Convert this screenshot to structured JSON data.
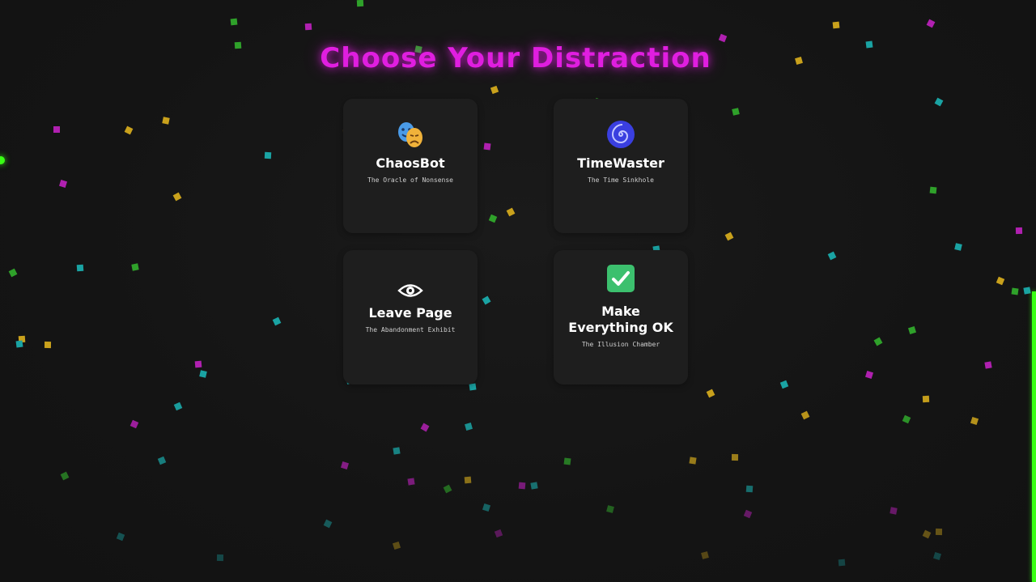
{
  "page": {
    "title": "Choose Your Distraction",
    "title_color": "#e01ee0",
    "background": "#141414",
    "accent_green": "#39ff14"
  },
  "cards": [
    {
      "id": "chaosbot",
      "title": "ChaosBot",
      "subtitle": "The Oracle of Nonsense",
      "icon": "theater-masks-icon"
    },
    {
      "id": "timewaster",
      "title": "TimeWaster",
      "subtitle": "The Time Sinkhole",
      "icon": "spiral-icon"
    },
    {
      "id": "leavepage",
      "title": "Leave Page",
      "subtitle": "The Abandonment Exhibit",
      "icon": "eye-icon"
    },
    {
      "id": "makeok",
      "title_line1": "Make",
      "title_line2": "Everything OK",
      "subtitle": "The Illusion Chamber",
      "icon": "check-box-icon"
    }
  ],
  "confetti_colors": {
    "green": "#2fa12a",
    "magenta": "#b020b0",
    "teal": "#1aa3a3",
    "yellow": "#c9a11c"
  }
}
